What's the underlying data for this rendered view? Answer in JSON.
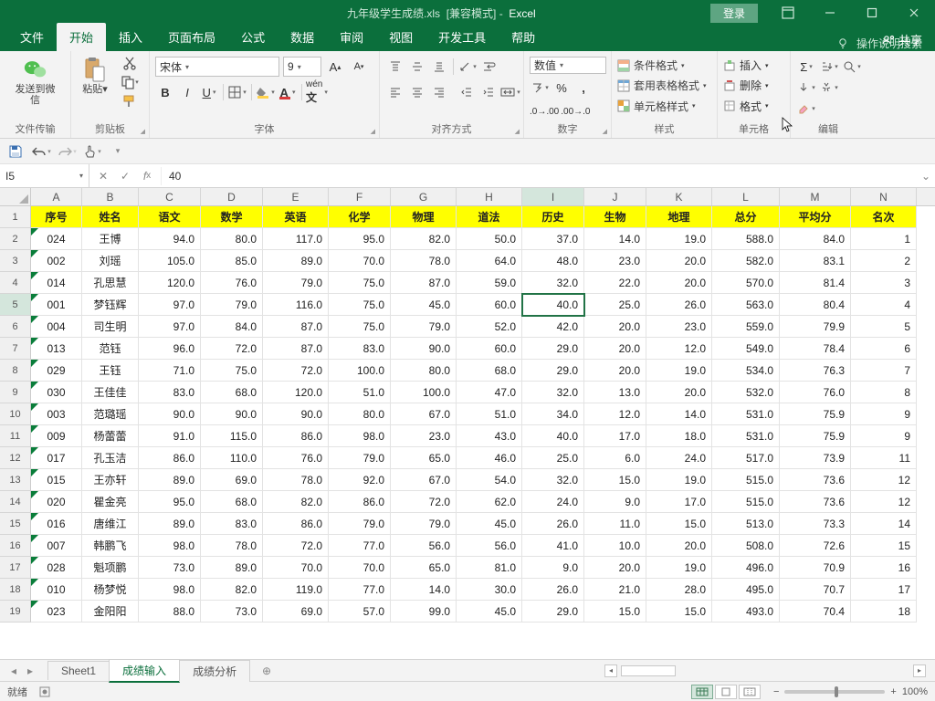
{
  "titlebar": {
    "filename": "九年级学生成绩.xls",
    "mode": "[兼容模式]",
    "app": "Excel",
    "login": "登录"
  },
  "ribbon": {
    "tabs": [
      "文件",
      "开始",
      "插入",
      "页面布局",
      "公式",
      "数据",
      "审阅",
      "视图",
      "开发工具",
      "帮助"
    ],
    "active_index": 1,
    "tell_me": "操作说明搜索",
    "share": "共享"
  },
  "ribbon_groups": {
    "wechat": {
      "big": "发送到微信",
      "label": "文件传输"
    },
    "clipboard": {
      "paste": "粘贴",
      "label": "剪贴板"
    },
    "font": {
      "name": "宋体",
      "size": "9",
      "label": "字体"
    },
    "align": {
      "label": "对齐方式"
    },
    "number": {
      "format": "数值",
      "label": "数字"
    },
    "styles": {
      "cond": "条件格式",
      "table": "套用表格格式",
      "cell": "单元格样式",
      "label": "样式"
    },
    "cells": {
      "insert": "插入",
      "delete": "删除",
      "format": "格式",
      "label": "单元格"
    },
    "editing": {
      "label": "编辑"
    }
  },
  "name_box": "I5",
  "formula": "40",
  "columns": [
    "A",
    "B",
    "C",
    "D",
    "E",
    "F",
    "G",
    "H",
    "I",
    "J",
    "K",
    "L",
    "M",
    "N"
  ],
  "headers": [
    "序号",
    "姓名",
    "语文",
    "数学",
    "英语",
    "化学",
    "物理",
    "道法",
    "历史",
    "生物",
    "地理",
    "总分",
    "平均分",
    "名次"
  ],
  "rows": [
    {
      "n": 1
    },
    {
      "n": 2,
      "d": [
        "024",
        "王博",
        "94.0",
        "80.0",
        "117.0",
        "95.0",
        "82.0",
        "50.0",
        "37.0",
        "14.0",
        "19.0",
        "588.0",
        "84.0",
        "1"
      ]
    },
    {
      "n": 3,
      "d": [
        "002",
        "刘瑶",
        "105.0",
        "85.0",
        "89.0",
        "70.0",
        "78.0",
        "64.0",
        "48.0",
        "23.0",
        "20.0",
        "582.0",
        "83.1",
        "2"
      ]
    },
    {
      "n": 4,
      "d": [
        "014",
        "孔思慧",
        "120.0",
        "76.0",
        "79.0",
        "75.0",
        "87.0",
        "59.0",
        "32.0",
        "22.0",
        "20.0",
        "570.0",
        "81.4",
        "3"
      ]
    },
    {
      "n": 5,
      "d": [
        "001",
        "梦钰辉",
        "97.0",
        "79.0",
        "116.0",
        "75.0",
        "45.0",
        "60.0",
        "40.0",
        "25.0",
        "26.0",
        "563.0",
        "80.4",
        "4"
      ]
    },
    {
      "n": 6,
      "d": [
        "004",
        "司生明",
        "97.0",
        "84.0",
        "87.0",
        "75.0",
        "79.0",
        "52.0",
        "42.0",
        "20.0",
        "23.0",
        "559.0",
        "79.9",
        "5"
      ]
    },
    {
      "n": 7,
      "d": [
        "013",
        "范钰",
        "96.0",
        "72.0",
        "87.0",
        "83.0",
        "90.0",
        "60.0",
        "29.0",
        "20.0",
        "12.0",
        "549.0",
        "78.4",
        "6"
      ]
    },
    {
      "n": 8,
      "d": [
        "029",
        "王钰",
        "71.0",
        "75.0",
        "72.0",
        "100.0",
        "80.0",
        "68.0",
        "29.0",
        "20.0",
        "19.0",
        "534.0",
        "76.3",
        "7"
      ]
    },
    {
      "n": 9,
      "d": [
        "030",
        "王佳佳",
        "83.0",
        "68.0",
        "120.0",
        "51.0",
        "100.0",
        "47.0",
        "32.0",
        "13.0",
        "20.0",
        "532.0",
        "76.0",
        "8"
      ]
    },
    {
      "n": 10,
      "d": [
        "003",
        "范璐瑶",
        "90.0",
        "90.0",
        "90.0",
        "80.0",
        "67.0",
        "51.0",
        "34.0",
        "12.0",
        "14.0",
        "531.0",
        "75.9",
        "9"
      ]
    },
    {
      "n": 11,
      "d": [
        "009",
        "杨蕾蕾",
        "91.0",
        "115.0",
        "86.0",
        "98.0",
        "23.0",
        "43.0",
        "40.0",
        "17.0",
        "18.0",
        "531.0",
        "75.9",
        "9"
      ]
    },
    {
      "n": 12,
      "d": [
        "017",
        "孔玉洁",
        "86.0",
        "110.0",
        "76.0",
        "79.0",
        "65.0",
        "46.0",
        "25.0",
        "6.0",
        "24.0",
        "517.0",
        "73.9",
        "11"
      ]
    },
    {
      "n": 13,
      "d": [
        "015",
        "王亦轩",
        "89.0",
        "69.0",
        "78.0",
        "92.0",
        "67.0",
        "54.0",
        "32.0",
        "15.0",
        "19.0",
        "515.0",
        "73.6",
        "12"
      ]
    },
    {
      "n": 14,
      "d": [
        "020",
        "瞿金亮",
        "95.0",
        "68.0",
        "82.0",
        "86.0",
        "72.0",
        "62.0",
        "24.0",
        "9.0",
        "17.0",
        "515.0",
        "73.6",
        "12"
      ]
    },
    {
      "n": 15,
      "d": [
        "016",
        "唐维江",
        "89.0",
        "83.0",
        "86.0",
        "79.0",
        "79.0",
        "45.0",
        "26.0",
        "11.0",
        "15.0",
        "513.0",
        "73.3",
        "14"
      ]
    },
    {
      "n": 16,
      "d": [
        "007",
        "韩鹏飞",
        "98.0",
        "78.0",
        "72.0",
        "77.0",
        "56.0",
        "56.0",
        "41.0",
        "10.0",
        "20.0",
        "508.0",
        "72.6",
        "15"
      ]
    },
    {
      "n": 17,
      "d": [
        "028",
        "魁项鹏",
        "73.0",
        "89.0",
        "70.0",
        "70.0",
        "65.0",
        "81.0",
        "9.0",
        "20.0",
        "19.0",
        "496.0",
        "70.9",
        "16"
      ]
    },
    {
      "n": 18,
      "d": [
        "010",
        "杨梦悦",
        "98.0",
        "82.0",
        "119.0",
        "77.0",
        "14.0",
        "30.0",
        "26.0",
        "21.0",
        "28.0",
        "495.0",
        "70.7",
        "17"
      ]
    },
    {
      "n": 19,
      "d": [
        "023",
        "金阳阳",
        "88.0",
        "73.0",
        "69.0",
        "57.0",
        "99.0",
        "45.0",
        "29.0",
        "15.0",
        "15.0",
        "493.0",
        "70.4",
        "18"
      ]
    }
  ],
  "selected": {
    "row_index": 5,
    "col": "I"
  },
  "sheet_tabs": {
    "tabs": [
      "Sheet1",
      "成绩输入",
      "成绩分析"
    ],
    "active": 1
  },
  "statusbar": {
    "ready": "就绪",
    "zoom": "100%"
  }
}
